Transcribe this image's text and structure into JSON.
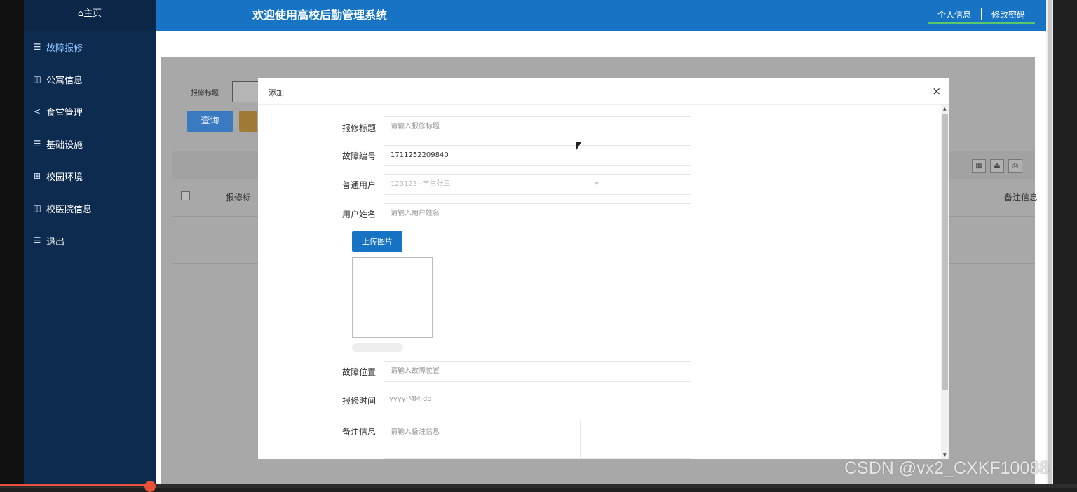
{
  "sidebar": {
    "home": "⌂主页",
    "items": [
      {
        "label": "故障报修",
        "icon": "list-icon",
        "glyph": "☰",
        "active": true
      },
      {
        "label": "公寓信息",
        "icon": "book-icon",
        "glyph": "◫",
        "active": false
      },
      {
        "label": "食堂管理",
        "icon": "share-icon",
        "glyph": "<",
        "active": false
      },
      {
        "label": "基础设施",
        "icon": "list-icon",
        "glyph": "☰",
        "active": false
      },
      {
        "label": "校园环境",
        "icon": "grid-icon",
        "glyph": "⊞",
        "active": false
      },
      {
        "label": "校医院信息",
        "icon": "book-icon",
        "glyph": "◫",
        "active": false
      },
      {
        "label": "退出",
        "icon": "list-icon",
        "glyph": "☰",
        "active": false
      }
    ]
  },
  "header": {
    "title": "欢迎使用高校后勤管理系统",
    "links": [
      "个人信息",
      "修改密码"
    ]
  },
  "background": {
    "search_label": "报修标题",
    "query_button": "查询",
    "col_title": "报修标",
    "col_remark": "备注信息"
  },
  "dialog": {
    "title": "添加",
    "close": "×",
    "fields": {
      "title": {
        "label": "报修标题",
        "placeholder": "请输入报修标题"
      },
      "code": {
        "label": "故障编号",
        "value": "1711252209840"
      },
      "user": {
        "label": "普通用户",
        "value": "123123--学生张三"
      },
      "username": {
        "label": "用户姓名",
        "placeholder": "请输入用户姓名"
      },
      "upload": {
        "button": "上传图片"
      },
      "location": {
        "label": "故障位置",
        "placeholder": "请输入故障位置"
      },
      "time": {
        "label": "报修时间",
        "placeholder": "yyyy-MM-dd"
      },
      "remark": {
        "label": "备注信息",
        "placeholder": "请输入备注信息"
      }
    }
  },
  "watermark": "CSDN @vx2_CXKF10088",
  "colors": {
    "sidebar": "#0d2b4f",
    "topbar": "#1774c5",
    "accent_green": "#5cc66b",
    "video_progress": "#e8503a"
  }
}
